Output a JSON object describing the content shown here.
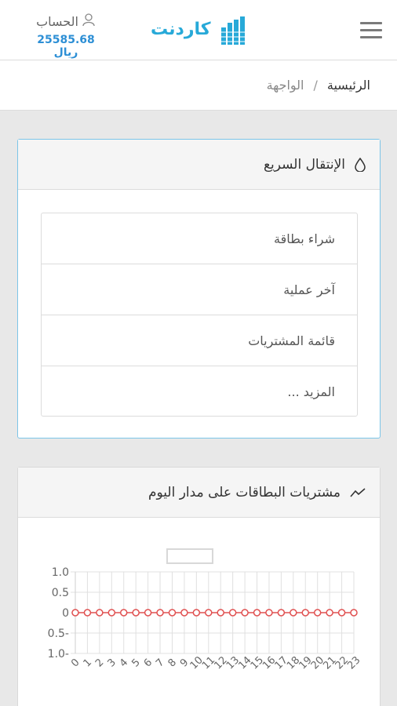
{
  "header": {
    "account_label": "الحساب",
    "balance": "25585.68 ريال",
    "logo_text": "كاردنت"
  },
  "breadcrumb": {
    "home": "الرئيسية",
    "separator": "/",
    "current": "الواجهة"
  },
  "quick_nav": {
    "title": "الإنتقال السريع",
    "items": [
      {
        "label": "شراء بطاقة"
      },
      {
        "label": "آخر عملية"
      },
      {
        "label": "قائمة المشتريات"
      },
      {
        "label": "المزيد ..."
      }
    ]
  },
  "chart_card": {
    "title": "مشتريات البطاقات على مدار اليوم"
  },
  "chart_data": {
    "type": "line",
    "x": [
      "0",
      "1",
      "2",
      "3",
      "4",
      "5",
      "6",
      "7",
      "8",
      "9",
      "10",
      "11",
      "12",
      "13",
      "14",
      "15",
      "16",
      "17",
      "18",
      "19",
      "20",
      "21",
      "22",
      "23"
    ],
    "series": [
      {
        "values": [
          0,
          0,
          0,
          0,
          0,
          0,
          0,
          0,
          0,
          0,
          0,
          0,
          0,
          0,
          0,
          0,
          0,
          0,
          0,
          0,
          0,
          0,
          0,
          0
        ]
      }
    ],
    "yticks": [
      "1.0",
      "0.5",
      "0",
      "0.5-",
      "1.0-"
    ],
    "ylim": [
      -1,
      1
    ],
    "grid": true,
    "line_color": "#e05050"
  },
  "colors": {
    "accent": "#2d8fd5",
    "logo": "#27a9d8",
    "active_border": "#7cc5e8"
  }
}
